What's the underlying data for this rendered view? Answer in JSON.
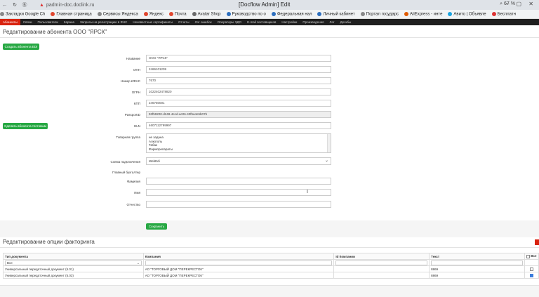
{
  "browser": {
    "url": "padmin-doc.doclink.ru",
    "window_title": "[Docflow Admin] Edit",
    "zoom": "67 %",
    "bookmarks": [
      "Закладки Google Ch",
      "Главная страница",
      "Сервисы Яндекса",
      "Яндекс",
      "Почта",
      "Avatar Shop",
      "Руководство по о",
      "Федеральная нал",
      "Личный кабинет",
      "Портал государс",
      "AliExpress - инте",
      "Авито | Объявле",
      "Бесплатн"
    ],
    "bookmark_colors": [
      "#888888",
      "#e0462e",
      "#888888",
      "#e0462e",
      "#e0462e",
      "#6a6a6a",
      "#2d6fbf",
      "#2d6fbf",
      "#2d6fbf",
      "#888888",
      "#e05a00",
      "#1aa4e0",
      "#d33"
    ]
  },
  "topnav": [
    "Абоненты",
    "Связи",
    "Пользователи",
    "Карана",
    "Запросы на регистрацию в ФНС",
    "Неизвестные сертификаты",
    "Отчеты",
    "Лог ошибок",
    "Операторы ЭДО",
    "E-mail поставщиков",
    "Настройки",
    "Произведения",
    "Лог",
    "Дескбы"
  ],
  "page_title": "Редактирование абонента ООО \"ЯРСК\"",
  "buttons": {
    "create_edi": "Создать абонента EDI",
    "create_test": "Сделать абонента тестовым",
    "save": "Сохранить"
  },
  "form": {
    "name_label": "Название",
    "name_value": "ООО \"ЯРСК\"",
    "inn_label": "ИНН",
    "inn_value": "2466101209",
    "ifns_label": "Номер ИФНС",
    "ifns_value": "7670",
    "ogrn_label": "ОГРН",
    "ogrn_value": "1022402478820",
    "kpp_label": "КПП",
    "kpp_value": "246750001",
    "passport_label": "PassportID",
    "passport_value": "93f59200-d248-4ecd-ac06-40f5a4e5b07b",
    "gln_label": "GLN",
    "gln_value": "4607112799997",
    "goods_label": "Товарная группа",
    "goods_options": [
      "не задана",
      "Алкоголь",
      "Табак",
      "Фармпрепараты"
    ],
    "scheme_label": "Схема подключения",
    "scheme_value": "WebEdi",
    "accountant_label": "Главный бухгалтер",
    "lastname_label": "Фамилия",
    "lastname_value": "",
    "firstname_label": "Имя",
    "firstname_value": "",
    "patronymic_label": "Отчество",
    "patronymic_value": ""
  },
  "factoring": {
    "title": "Редактирование опции факторинга",
    "headers": {
      "doc_type": "Тип документа",
      "company": "Компания",
      "company_id": "Id Компании",
      "text": "Текст",
      "all": "Все"
    },
    "filter_value": "Все",
    "rows": [
      {
        "doc_type": "Универсальный передаточный документ (5.01)",
        "company": "АО \"ТОРГОВЫЙ ДОМ \"ПЕРЕКРЕСТОК\"",
        "company_id": "",
        "text": "8869",
        "checked": false
      },
      {
        "doc_type": "Универсальный передаточный документ (5.03)",
        "company": "АО \"ТОРГОВЫЙ ДОМ \"ПЕРЕКРЕСТОК\"",
        "company_id": "",
        "text": "8869",
        "checked": true
      }
    ]
  }
}
